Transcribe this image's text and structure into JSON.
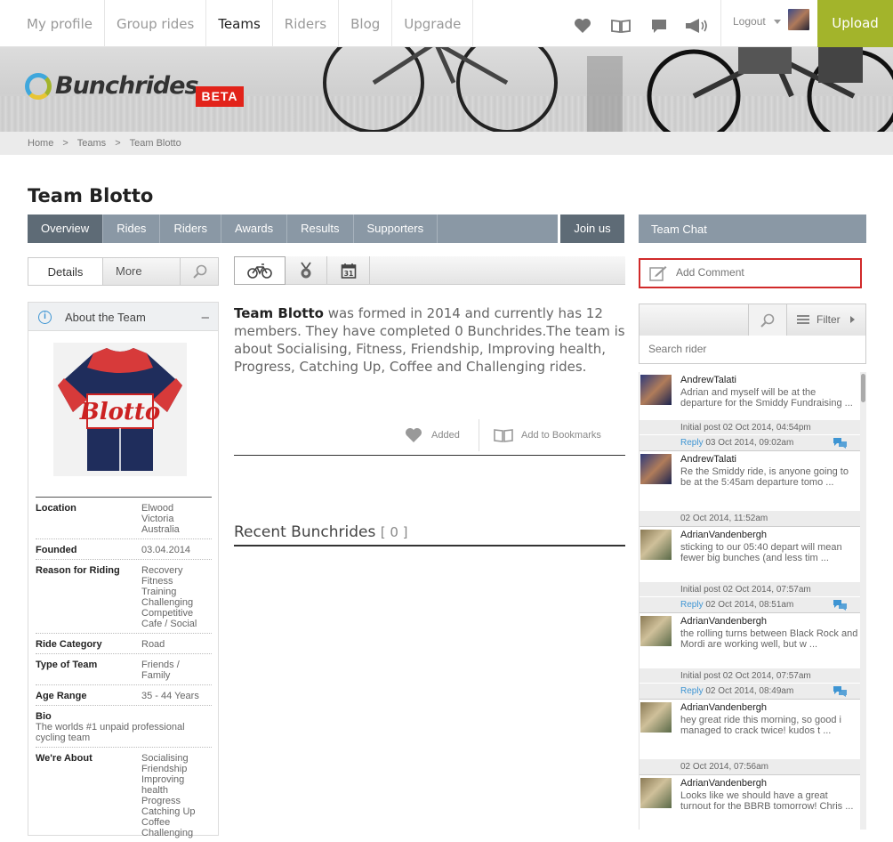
{
  "nav": {
    "items": [
      "My profile",
      "Group rides",
      "Teams",
      "Riders",
      "Blog",
      "Upgrade"
    ],
    "logout": "Logout",
    "upload": "Upload"
  },
  "brand": {
    "name": "Bunchrides",
    "beta": "BETA"
  },
  "breadcrumb": [
    "Home",
    "Teams",
    "Team Blotto"
  ],
  "page_title": "Team Blotto",
  "tabs": [
    "Overview",
    "Rides",
    "Riders",
    "Awards",
    "Results",
    "Supporters"
  ],
  "join_us": "Join us",
  "team_chat": "Team Chat",
  "subtabs": {
    "details": "Details",
    "more": "More"
  },
  "about": {
    "heading": "About the Team",
    "fields": [
      {
        "k": "Location",
        "v": "Elwood\nVictoria\nAustralia"
      },
      {
        "k": "Founded",
        "v": "03.04.2014"
      },
      {
        "k": "Reason for Riding",
        "v": "Recovery\nFitness\nTraining\nChallenging\nCompetitive\nCafe / Social"
      },
      {
        "k": "Ride Category",
        "v": "Road"
      },
      {
        "k": "Type of Team",
        "v": "Friends /\nFamily"
      },
      {
        "k": "Age Range",
        "v": "35 - 44 Years"
      }
    ],
    "bio_label": "Bio",
    "bio": "The worlds #1 unpaid professional cycling team",
    "about_label": "We're About",
    "about_value": "Socialising\nFriendship\nImproving\nhealth\nProgress\nCatching Up\nCoffee\nChallenging"
  },
  "description": {
    "team": "Team Blotto",
    "text": " was formed in 2014 and currently has 12 members. They have completed 0 Bunchrides.The team is about Socialising, Fitness, Friendship, Improving health, Progress, Catching Up, Coffee and Challenging rides."
  },
  "actions": {
    "added": "Added",
    "bookmark": "Add to Bookmarks"
  },
  "recent": {
    "title": "Recent Bunchrides",
    "count": "[ 0 ]"
  },
  "chat": {
    "add_comment_placeholder": "Add Comment",
    "filter": "Filter",
    "search_placeholder": "Search rider",
    "posts": [
      {
        "name": "AndrewTalati",
        "text": "Adrian and myself will be at the departure for the Smiddy Fundraising ...",
        "initial": "Initial post 02 Oct 2014, 04:54pm",
        "reply": "Reply",
        "date": "03 Oct 2014, 09:02am"
      },
      {
        "name": "AndrewTalati",
        "text": "Re the Smiddy ride, is anyone going to be at the 5:45am departure tomo ...",
        "initial": "",
        "reply": "",
        "date": "02 Oct 2014, 11:52am"
      },
      {
        "name": "AdrianVandenbergh",
        "text": "sticking to our 05:40 depart will mean fewer big bunches (and less tim ...",
        "initial": "Initial post 02 Oct 2014, 07:57am",
        "reply": "Reply",
        "date": "02 Oct 2014, 08:51am"
      },
      {
        "name": "AdrianVandenbergh",
        "text": "the rolling turns between Black Rock and Mordi are working well, but w ...",
        "initial": "Initial post 02 Oct 2014, 07:57am",
        "reply": "Reply",
        "date": "02 Oct 2014, 08:49am"
      },
      {
        "name": "AdrianVandenbergh",
        "text": "hey great ride this morning, so good i managed to crack twice! kudos t ...",
        "initial": "",
        "reply": "",
        "date": "02 Oct 2014, 07:56am"
      },
      {
        "name": "AdrianVandenbergh",
        "text": "Looks like we should have a great turnout for the BBRB tomorrow! Chris ...",
        "initial": "",
        "reply": "",
        "date": ""
      }
    ]
  },
  "colors": {
    "accent": "#a3b42b",
    "tab_bg": "#8a98a5",
    "tab_active": "#5e6b76",
    "beta": "#e2231a",
    "link": "#3e95d3"
  }
}
